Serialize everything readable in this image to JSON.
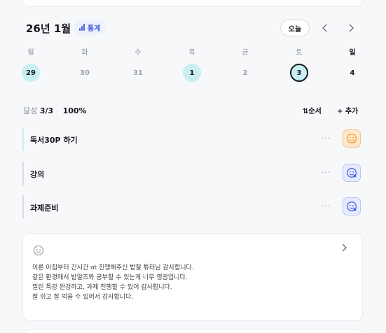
{
  "calendar": {
    "month_title": "26년 1월",
    "stats_label": "통계",
    "today_label": "오늘",
    "weekdays": [
      "월",
      "화",
      "수",
      "목",
      "금",
      "토",
      "일"
    ],
    "dates": [
      "29",
      "30",
      "31",
      "1",
      "2",
      "3",
      "4"
    ]
  },
  "progress": {
    "label": "달성",
    "done": "3/3",
    "percent": "100%",
    "sort_label": "⇅순서",
    "add_label": "+ 추가"
  },
  "tasks": [
    {
      "title": "독서30P 하기",
      "bar_color": "#c9eef3",
      "mood": "orange"
    },
    {
      "title": "강의",
      "bar_color": "#d8dbe2",
      "mood": "blue"
    },
    {
      "title": "과제준비",
      "bar_color": "#d8dbe2",
      "mood": "blue"
    }
  ],
  "memo": {
    "lines": [
      "이른 아침부터 긴시간 ot 진행해주신 밥잘 튜터님 감사합니다.",
      "같은 환경에서 밥알즈와 공부할 수 있는게 너무 영광입니다.",
      "밀린 특강 완강하고, 과제 진행할 수 있어 감사합니다.",
      "잘 쉬고 잘 먹을 수 있어서 감사합니다."
    ]
  },
  "icons": {
    "stats": "bar-chart-icon",
    "prev": "chevron-left-icon",
    "next": "chevron-right-icon",
    "mood_orange": "face-orange-icon",
    "mood_blue": "face-blue-icon",
    "memo_face": "smile-outline-icon",
    "memo_open": "chevron-right-icon"
  },
  "colors": {
    "accent_blue": "#4a63e0",
    "done_teal": "#c9eef3",
    "orange": "#f39c3a"
  }
}
